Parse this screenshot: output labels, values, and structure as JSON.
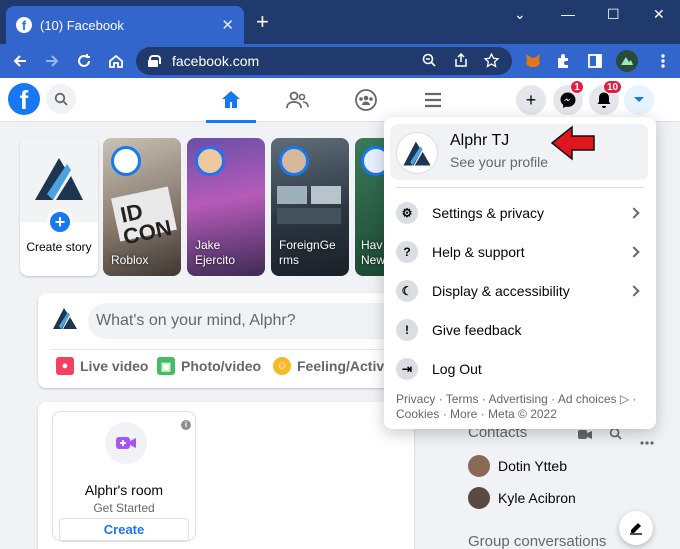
{
  "browser": {
    "tab_title": "(10) Facebook",
    "tab_close": "✕",
    "new_tab": "+",
    "window_controls": [
      "⌄",
      "—",
      "☐",
      "✕"
    ],
    "url": "facebook.com"
  },
  "header": {
    "logo": "f",
    "messenger_badge": "1",
    "notifications_badge": "10",
    "create_glyph": "+"
  },
  "stories": {
    "create_label": "Create story",
    "items": [
      {
        "name": "Roblox",
        "color": "#8a7a6e"
      },
      {
        "name": "Jake Ejercito",
        "color": "#a05ab0"
      },
      {
        "name": "ForeignGe rms",
        "color": "#4a5a66"
      },
      {
        "name": "Hav New",
        "color": "#3a6a4e"
      }
    ]
  },
  "composer": {
    "placeholder": "What's on your mind, Alphr?",
    "live_video": "Live video",
    "photo_video": "Photo/video",
    "feeling": "Feeling/Activi"
  },
  "room": {
    "title": "Alphr's room",
    "subtitle": "Get Started",
    "button": "Create"
  },
  "right_column": {
    "contacts_title": "Contacts",
    "contacts": [
      "Dotin Ytteb",
      "Kyle Acibron"
    ],
    "group_title": "Group conversations"
  },
  "menu": {
    "profile_name": "Alphr TJ",
    "profile_sub": "See your profile",
    "items": [
      {
        "label": "Settings & privacy",
        "glyph": "⚙",
        "chevron": true
      },
      {
        "label": "Help & support",
        "glyph": "?",
        "chevron": true
      },
      {
        "label": "Display & accessibility",
        "glyph": "☾",
        "chevron": true
      },
      {
        "label": "Give feedback",
        "glyph": "!",
        "chevron": false
      },
      {
        "label": "Log Out",
        "glyph": "⇥",
        "chevron": false
      }
    ],
    "footer": "Privacy · Terms · Advertising · Ad choices ▷ · Cookies · More · Meta © 2022"
  },
  "colors": {
    "fb_blue": "#1877f2",
    "chrome_blue": "#3366cc",
    "chrome_dark": "#203a6e",
    "arrow_red": "#e0151e"
  }
}
